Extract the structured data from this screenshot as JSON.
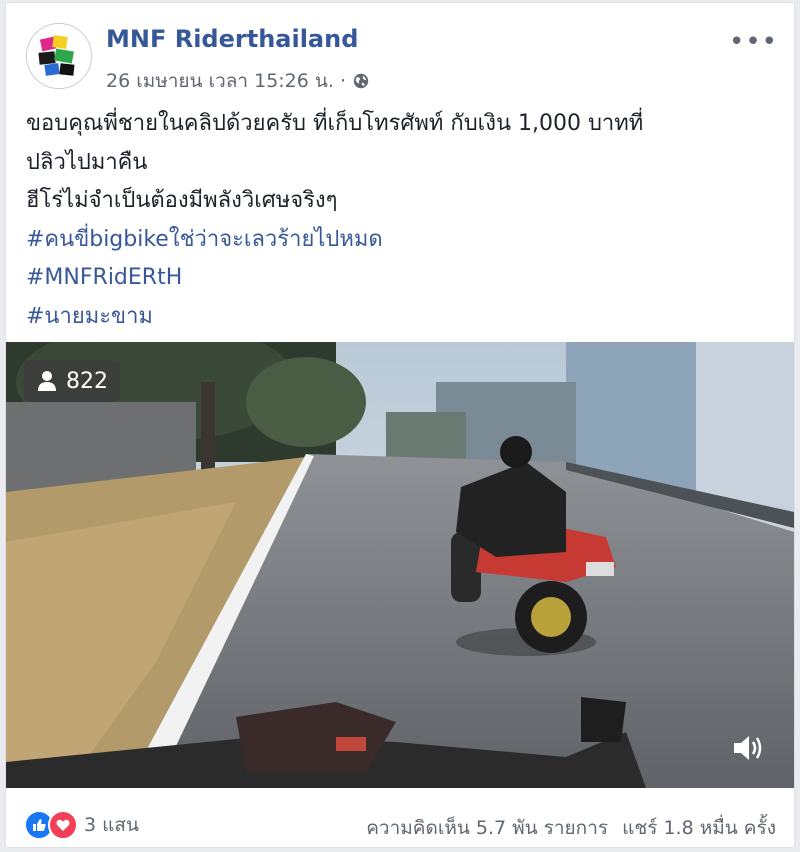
{
  "post": {
    "page_name": "MNF Riderthailand",
    "timestamp": "26 เมษายน เวลา 15:26 น.",
    "separator": "·",
    "privacy_icon": "globe-icon",
    "more_label": "•••",
    "text_lines": [
      "ขอบคุณพี่ชายในคลิปด้วยครับ ที่เก็บโทรศัพท์ กับเงิน 1,000 บาทที่",
      "ปลิวไปมาคืน",
      "ฮีโร่ไม่จำเป็นต้องมีพลังวิเศษจริงๆ"
    ],
    "hashtags": [
      "#คนขี่bigbikeใช่ว่าจะเลวร้ายไปหมด",
      "#MNFRidERtH",
      "#นายมะขาม"
    ]
  },
  "video": {
    "view_count": "822",
    "viewer_icon": "person-icon",
    "volume_icon": "volume-icon"
  },
  "footer": {
    "reaction_icons": [
      "like-icon",
      "love-icon"
    ],
    "reaction_count": "3 แสน",
    "comments": "ความคิดเห็น 5.7 พัน รายการ",
    "shares": "แชร์ 1.8 หมื่น ครั้ง"
  },
  "colors": {
    "link": "#365899",
    "hashtag": "#385898",
    "like": "#1877f2",
    "love": "#f33e58"
  }
}
